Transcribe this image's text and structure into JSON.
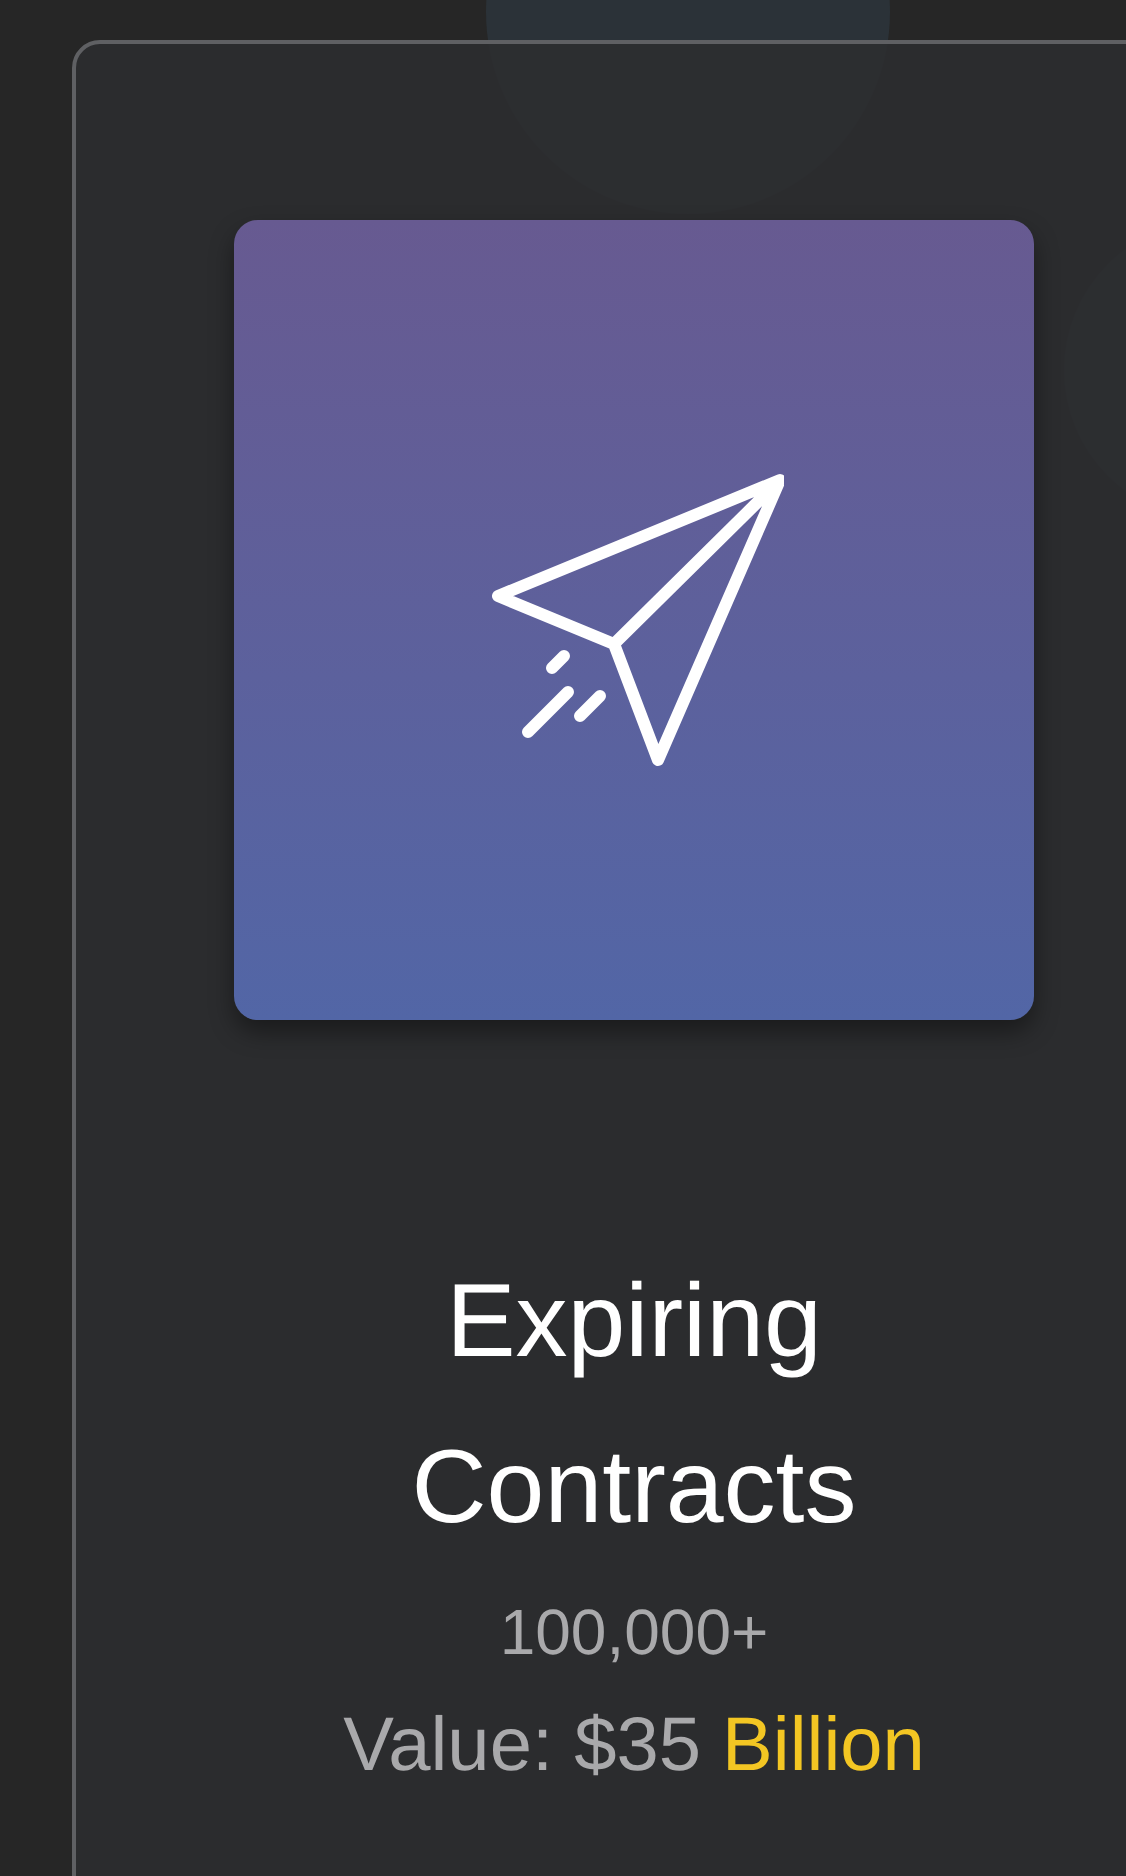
{
  "card": {
    "title": "Expiring Contracts",
    "count": "100,000+",
    "value_label": "Value: $35",
    "value_highlight": "Billion"
  }
}
